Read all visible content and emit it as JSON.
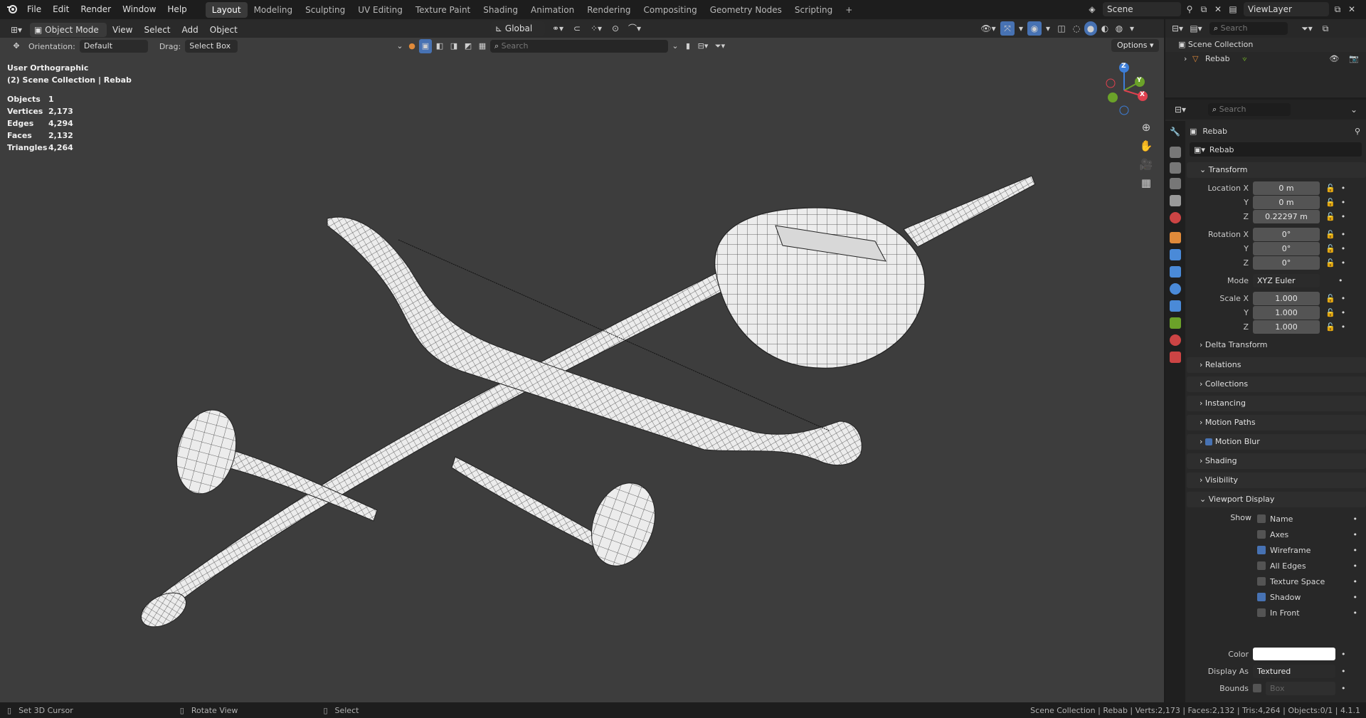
{
  "topbar": {
    "menus": [
      "File",
      "Edit",
      "Render",
      "Window",
      "Help"
    ],
    "workspaces": [
      "Layout",
      "Modeling",
      "Sculpting",
      "UV Editing",
      "Texture Paint",
      "Shading",
      "Animation",
      "Rendering",
      "Compositing",
      "Geometry Nodes",
      "Scripting"
    ],
    "active_workspace": "Layout",
    "add_tab": "+",
    "scene": "Scene",
    "view_layer": "ViewLayer"
  },
  "viewport_header": {
    "mode": "Object Mode",
    "menus": [
      "View",
      "Select",
      "Add",
      "Object"
    ],
    "orientation_label": "Orientation:",
    "orientation_value": "Default",
    "drag_label": "Drag:",
    "drag_value": "Select Box",
    "transform_orientation": "Global",
    "search_placeholder": "Search",
    "options": "Options"
  },
  "overlay": {
    "view_name": "User Orthographic",
    "collection_info": "(2) Scene Collection | Rebab",
    "stats": [
      {
        "key": "Objects",
        "value": "1"
      },
      {
        "key": "Vertices",
        "value": "2,173"
      },
      {
        "key": "Edges",
        "value": "4,294"
      },
      {
        "key": "Faces",
        "value": "2,132"
      },
      {
        "key": "Triangles",
        "value": "4,264"
      }
    ]
  },
  "gizmo": {
    "x": "X",
    "y": "Y",
    "z": "Z"
  },
  "outliner": {
    "search_placeholder": "Search",
    "collection": "Scene Collection",
    "object": "Rebab"
  },
  "properties": {
    "search_placeholder": "Search",
    "object_name": "Rebab",
    "object_field": "Rebab",
    "transform": {
      "title": "Transform",
      "location_label": "Location X",
      "location": [
        "0 m",
        "0 m",
        "0.22297 m"
      ],
      "rotation_label": "Rotation X",
      "rotation": [
        "0°",
        "0°",
        "0°"
      ],
      "mode_label": "Mode",
      "mode": "XYZ Euler",
      "scale_label": "Scale X",
      "scale": [
        "1.000",
        "1.000",
        "1.000"
      ],
      "y": "Y",
      "z": "Z",
      "delta": "Delta Transform"
    },
    "panels": [
      "Relations",
      "Collections",
      "Instancing",
      "Motion Paths",
      "Motion Blur",
      "Shading",
      "Visibility"
    ],
    "viewport_display": {
      "title": "Viewport Display",
      "show_label": "Show",
      "checks": [
        {
          "label": "Name",
          "on": false
        },
        {
          "label": "Axes",
          "on": false
        },
        {
          "label": "Wireframe",
          "on": true
        },
        {
          "label": "All Edges",
          "on": false
        },
        {
          "label": "Texture Space",
          "on": false
        },
        {
          "label": "Shadow",
          "on": true
        },
        {
          "label": "In Front",
          "on": false
        }
      ],
      "color_label": "Color",
      "display_as_label": "Display As",
      "display_as": "Textured",
      "bounds_label": "Bounds",
      "bounds_value": "Box"
    }
  },
  "statusbar": {
    "set_cursor": "Set 3D Cursor",
    "rotate": "Rotate View",
    "select": "Select",
    "info": "Scene Collection | Rebab | Verts:2,173 | Faces:2,132 | Tris:4,264 | Objects:0/1 | 4.1.1"
  },
  "colors": {
    "accent": "#4772b3",
    "x_axis": "#e0414f",
    "y_axis": "#6ba229",
    "z_axis": "#3d7ed8",
    "orange": "#e08a3a"
  }
}
